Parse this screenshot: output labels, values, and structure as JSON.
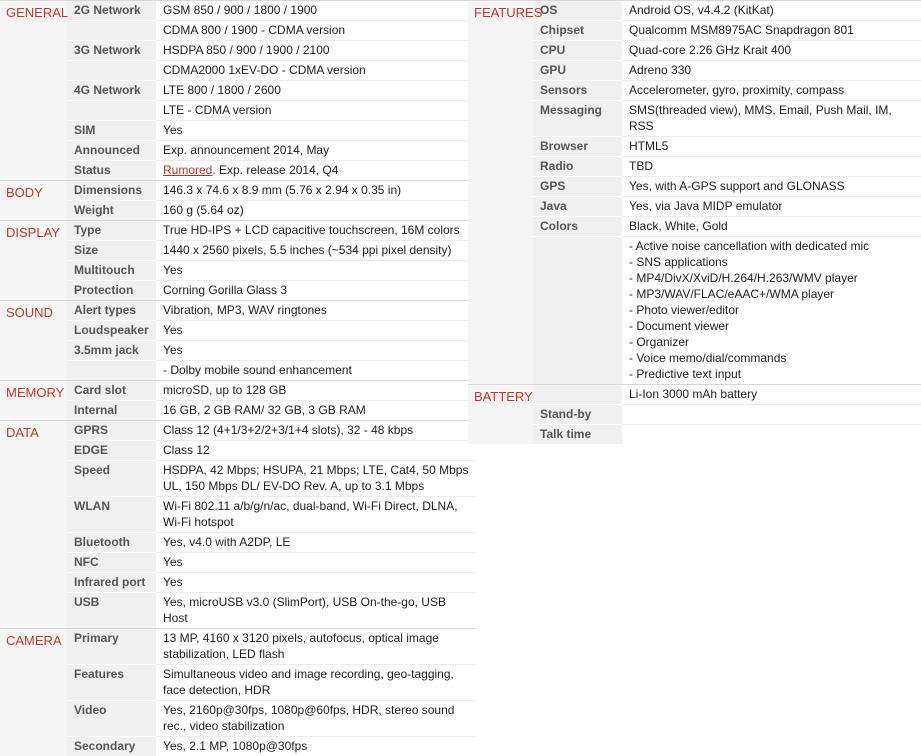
{
  "left": [
    {
      "category": "GENERAL",
      "rows": [
        {
          "label": "2G Network",
          "value": "GSM 850 / 900 / 1800 / 1900"
        },
        {
          "label": "",
          "value": "CDMA 800 / 1900 - CDMA version"
        },
        {
          "label": "3G Network",
          "value": "HSDPA 850 / 900 / 1900 / 2100"
        },
        {
          "label": "",
          "value": "CDMA2000 1xEV-DO - CDMA version"
        },
        {
          "label": "4G Network",
          "value": "LTE 800 / 1800 / 2600"
        },
        {
          "label": "",
          "value": "LTE - CDMA version"
        },
        {
          "label": "SIM",
          "value": "Yes"
        },
        {
          "label": "Announced",
          "value": "Exp. announcement 2014, May"
        },
        {
          "label": "Status",
          "link": "Rumored",
          "value": ". Exp. release 2014, Q4"
        }
      ]
    },
    {
      "category": "BODY",
      "rows": [
        {
          "label": "Dimensions",
          "value": "146.3 x 74.6 x 8.9 mm (5.76 x 2.94 x 0.35 in)"
        },
        {
          "label": "Weight",
          "value": "160 g (5.64 oz)"
        }
      ]
    },
    {
      "category": "DISPLAY",
      "rows": [
        {
          "label": "Type",
          "value": "True HD-IPS + LCD capacitive touchscreen, 16M colors"
        },
        {
          "label": "Size",
          "value": "1440 x 2560 pixels, 5.5 inches (~534 ppi pixel density)"
        },
        {
          "label": "Multitouch",
          "value": "Yes"
        },
        {
          "label": "Protection",
          "value": "Corning Gorilla Glass 3"
        }
      ]
    },
    {
      "category": "SOUND",
      "rows": [
        {
          "label": "Alert types",
          "value": "Vibration, MP3, WAV ringtones"
        },
        {
          "label": "Loudspeaker",
          "value": "Yes"
        },
        {
          "label": "3.5mm jack",
          "value": "Yes"
        },
        {
          "label": "",
          "value": "- Dolby mobile sound enhancement"
        }
      ]
    },
    {
      "category": "MEMORY",
      "rows": [
        {
          "label": "Card slot",
          "value": "microSD, up to 128 GB"
        },
        {
          "label": "Internal",
          "value": "16 GB, 2 GB RAM/ 32 GB, 3 GB RAM"
        }
      ]
    },
    {
      "category": "DATA",
      "rows": [
        {
          "label": "GPRS",
          "value": "Class 12 (4+1/3+2/2+3/1+4 slots), 32 - 48 kbps"
        },
        {
          "label": "EDGE",
          "value": "Class 12"
        },
        {
          "label": "Speed",
          "value": "HSDPA, 42 Mbps; HSUPA, 21 Mbps; LTE, Cat4, 50 Mbps UL, 150 Mbps DL/ EV-DO Rev. A, up to 3.1 Mbps"
        },
        {
          "label": "WLAN",
          "value": "Wi-Fi 802.11 a/b/g/n/ac, dual-band, Wi-Fi Direct, DLNA, Wi-Fi hotspot"
        },
        {
          "label": "Bluetooth",
          "value": "Yes, v4.0 with A2DP, LE"
        },
        {
          "label": "NFC",
          "value": "Yes"
        },
        {
          "label": "Infrared port",
          "value": "Yes"
        },
        {
          "label": "USB",
          "value": "Yes, microUSB v3.0 (SlimPort), USB On-the-go, USB Host"
        }
      ]
    },
    {
      "category": "CAMERA",
      "rows": [
        {
          "label": "Primary",
          "value": "13 MP, 4160 x 3120 pixels, autofocus, optical image stabilization, LED flash"
        },
        {
          "label": "Features",
          "value": "Simultaneous video and image recording, geo-tagging, face detection, HDR"
        },
        {
          "label": "Video",
          "value": "Yes, 2160p@30fps, 1080p@60fps, HDR, stereo sound rec., video stabilization"
        },
        {
          "label": "Secondary",
          "value": "Yes, 2.1 MP, 1080p@30fps"
        }
      ]
    }
  ],
  "right": [
    {
      "category": "FEATURES",
      "rows": [
        {
          "label": "OS",
          "value": "Android OS, v4.4.2 (KitKat)"
        },
        {
          "label": "Chipset",
          "value": "Qualcomm MSM8975AC Snapdragon 801"
        },
        {
          "label": "CPU",
          "value": "Quad-core 2.26 GHz Krait 400"
        },
        {
          "label": "GPU",
          "value": "Adreno 330"
        },
        {
          "label": "Sensors",
          "value": "Accelerometer, gyro, proximity, compass"
        },
        {
          "label": "Messaging",
          "value": "SMS(threaded view), MMS, Email, Push Mail, IM, RSS"
        },
        {
          "label": "Browser",
          "value": "HTML5"
        },
        {
          "label": "Radio",
          "value": "TBD"
        },
        {
          "label": "GPS",
          "value": "Yes, with A-GPS support and GLONASS"
        },
        {
          "label": "Java",
          "value": "Yes, via Java MIDP emulator"
        },
        {
          "label": "Colors",
          "value": "Black, White, Gold"
        },
        {
          "label": "",
          "value": "- Active noise cancellation with dedicated mic\n- SNS applications\n- MP4/DivX/XviD/H.264/H.263/WMV player\n- MP3/WAV/FLAC/eAAC+/WMA player\n- Photo viewer/editor\n- Document viewer\n- Organizer\n- Voice memo/dial/commands\n- Predictive text input"
        }
      ]
    },
    {
      "category": "BATTERY",
      "rows": [
        {
          "label": "",
          "value": "Li-Ion 3000 mAh battery"
        },
        {
          "label": "Stand-by",
          "value": ""
        },
        {
          "label": "Talk time",
          "value": ""
        }
      ]
    }
  ]
}
